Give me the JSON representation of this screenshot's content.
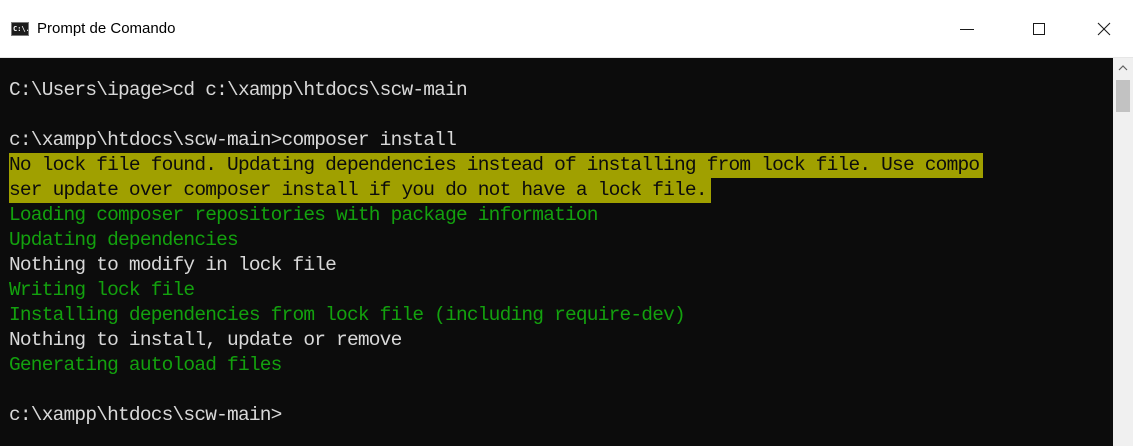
{
  "window": {
    "title": "Prompt de Comando",
    "icon": "cmd-icon",
    "icon_label": "C:\\."
  },
  "controls": {
    "minimize": "minimize-icon",
    "maximize": "maximize-icon",
    "close": "close-icon"
  },
  "console": {
    "lines": [
      "C:\\Users\\ipage>cd c:\\xampp\\htdocs\\scw-main",
      "c:\\xampp\\htdocs\\scw-main>composer install",
      "No lock file found. Updating dependencies instead of installing from lock file. Use compo",
      "ser update over composer install if you do not have a lock file.",
      "Loading composer repositories with package information",
      "Updating dependencies",
      "Nothing to modify in lock file",
      "Writing lock file",
      "Installing dependencies from lock file (including require-dev)",
      "Nothing to install, update or remove",
      "Generating autoload files",
      "c:\\xampp\\htdocs\\scw-main>"
    ]
  },
  "colors": {
    "background": "#0c0c0c",
    "text_default": "#d8d8d8",
    "text_green": "#13a10e",
    "warning_background": "#a0a000",
    "warning_text": "#0c0c0c"
  }
}
